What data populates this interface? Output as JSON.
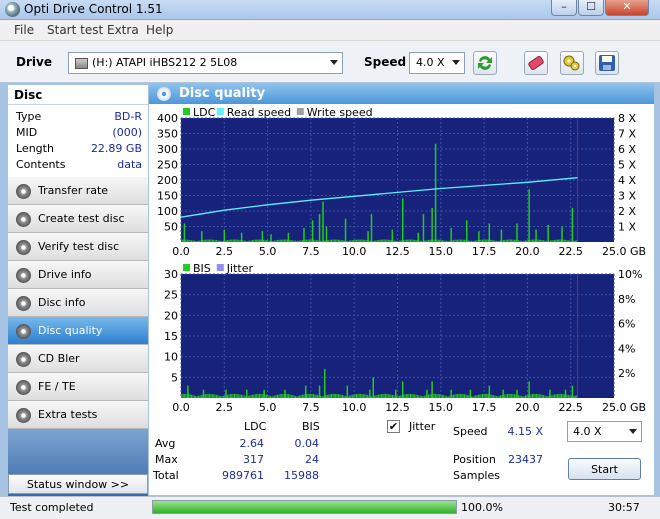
{
  "window": {
    "title": "Opti Drive Control 1.51",
    "controls": {
      "minimize": "–",
      "maximize": "☐",
      "close": "✕"
    }
  },
  "menu": [
    "File",
    "Start test",
    "Extra",
    "Help"
  ],
  "toolbar": {
    "drive_label": "Drive",
    "drive_value": "(H:)  ATAPI iHBS212  2 5L08",
    "speed_label": "Speed",
    "speed_value": "4.0 X"
  },
  "disc": {
    "header": "Disc",
    "rows": [
      {
        "key": "Type",
        "value": "BD-R"
      },
      {
        "key": "MID",
        "value": "(000)"
      },
      {
        "key": "Length",
        "value": "22.89 GB"
      },
      {
        "key": "Contents",
        "value": "data"
      }
    ]
  },
  "nav": [
    {
      "label": "Transfer rate",
      "active": false
    },
    {
      "label": "Create test disc",
      "active": false
    },
    {
      "label": "Verify test disc",
      "active": false
    },
    {
      "label": "Drive info",
      "active": false
    },
    {
      "label": "Disc info",
      "active": false
    },
    {
      "label": "Disc quality",
      "active": true
    },
    {
      "label": "CD Bler",
      "active": false
    },
    {
      "label": "FE / TE",
      "active": false
    },
    {
      "label": "Extra tests",
      "active": false
    }
  ],
  "status_window_label": "Status window >>",
  "panel_title": "Disc quality",
  "colors": {
    "ldc": "#1fcc1f",
    "read_speed": "#5ff0ff",
    "write_speed": "#a0a0a0",
    "bis": "#1fcc1f",
    "jitter": "#8f8fff",
    "plot_bg": "#17237a",
    "marker": "#c01818"
  },
  "chart_data": [
    {
      "type": "bar",
      "legend": [
        "LDC",
        "Read speed",
        "Write speed"
      ],
      "x_ticks": [
        "0.0",
        "2.5",
        "5.0",
        "7.5",
        "10.0",
        "12.5",
        "15.0",
        "17.5",
        "20.0",
        "22.5",
        "25.0 GB"
      ],
      "y_ticks_left": [
        "400",
        "350",
        "300",
        "250",
        "200",
        "150",
        "100",
        "50"
      ],
      "y_ticks_right": [
        "8 X",
        "7 X",
        "6 X",
        "5 X",
        "4 X",
        "3 X",
        "2 X",
        "1 X"
      ],
      "xlim": [
        0,
        25
      ],
      "ylim": [
        0,
        400
      ],
      "ylim_right": [
        0,
        8
      ],
      "marker_x": 22.89,
      "ldc_spikes": [
        [
          0.2,
          60
        ],
        [
          1.2,
          35
        ],
        [
          2.5,
          40
        ],
        [
          3.5,
          30
        ],
        [
          4.7,
          35
        ],
        [
          5.2,
          25
        ],
        [
          6.2,
          30
        ],
        [
          7.1,
          45
        ],
        [
          7.6,
          70
        ],
        [
          8.0,
          90
        ],
        [
          8.2,
          130
        ],
        [
          8.4,
          50
        ],
        [
          9.5,
          75
        ],
        [
          10.8,
          35
        ],
        [
          11.0,
          90
        ],
        [
          12.2,
          40
        ],
        [
          12.8,
          140
        ],
        [
          13.7,
          30
        ],
        [
          14.0,
          90
        ],
        [
          14.5,
          110
        ],
        [
          14.7,
          317
        ],
        [
          15.6,
          45
        ],
        [
          16.5,
          70
        ],
        [
          17.2,
          35
        ],
        [
          17.8,
          60
        ],
        [
          18.5,
          40
        ],
        [
          19.4,
          60
        ],
        [
          20.1,
          170
        ],
        [
          20.5,
          40
        ],
        [
          21.2,
          55
        ],
        [
          22.0,
          50
        ],
        [
          22.6,
          110
        ]
      ],
      "ldc_baseline": 8,
      "read_speed": [
        [
          0,
          1.6
        ],
        [
          2.5,
          2.05
        ],
        [
          5,
          2.4
        ],
        [
          7.5,
          2.7
        ],
        [
          10,
          2.95
        ],
        [
          12.5,
          3.2
        ],
        [
          15,
          3.45
        ],
        [
          17.5,
          3.65
        ],
        [
          20,
          3.85
        ],
        [
          22.89,
          4.15
        ]
      ]
    },
    {
      "type": "bar",
      "legend": [
        "BIS",
        "Jitter"
      ],
      "x_ticks": [
        "0.0",
        "2.5",
        "5.0",
        "7.5",
        "10.0",
        "12.5",
        "15.0",
        "17.5",
        "20.0",
        "22.5",
        "25.0 GB"
      ],
      "y_ticks_left": [
        "30",
        "25",
        "20",
        "15",
        "10",
        "5"
      ],
      "y_ticks_right": [
        "10%",
        "8%",
        "6%",
        "4%",
        "2%"
      ],
      "xlim": [
        0,
        25
      ],
      "ylim": [
        0,
        30
      ],
      "marker_x": 22.89,
      "bis_spikes": [
        [
          0.4,
          3
        ],
        [
          1.3,
          2
        ],
        [
          2.6,
          2
        ],
        [
          3.8,
          2
        ],
        [
          4.8,
          2
        ],
        [
          6.0,
          2
        ],
        [
          7.2,
          3
        ],
        [
          8.0,
          3
        ],
        [
          8.3,
          7
        ],
        [
          9.6,
          3
        ],
        [
          10.9,
          2
        ],
        [
          11.1,
          5
        ],
        [
          12.4,
          2
        ],
        [
          12.8,
          4
        ],
        [
          14.2,
          2
        ],
        [
          14.5,
          4
        ],
        [
          15.6,
          2
        ],
        [
          16.7,
          2
        ],
        [
          17.8,
          3
        ],
        [
          18.6,
          2
        ],
        [
          19.4,
          2
        ],
        [
          20.1,
          4
        ],
        [
          21.3,
          2
        ],
        [
          22.2,
          2
        ],
        [
          22.6,
          3
        ]
      ],
      "bis_baseline": 1
    }
  ],
  "stats": {
    "col_ldc": "LDC",
    "col_bis": "BIS",
    "rows": [
      {
        "label": "Avg",
        "ldc": "2.64",
        "bis": "0.04"
      },
      {
        "label": "Max",
        "ldc": "317",
        "bis": "24"
      },
      {
        "label": "Total",
        "ldc": "989761",
        "bis": "15988"
      }
    ],
    "jitter_label": "Jitter",
    "jitter_checked": "✔",
    "speed_label": "Speed",
    "speed_value": "4.15 X",
    "speed_select": "4.0 X",
    "position_label": "Position",
    "position_value": "23437",
    "samples_label": "Samples",
    "start_label": "Start"
  },
  "status": {
    "text": "Test completed",
    "progress_text": "100.0%",
    "progress": 1.0,
    "time": "30:57"
  }
}
